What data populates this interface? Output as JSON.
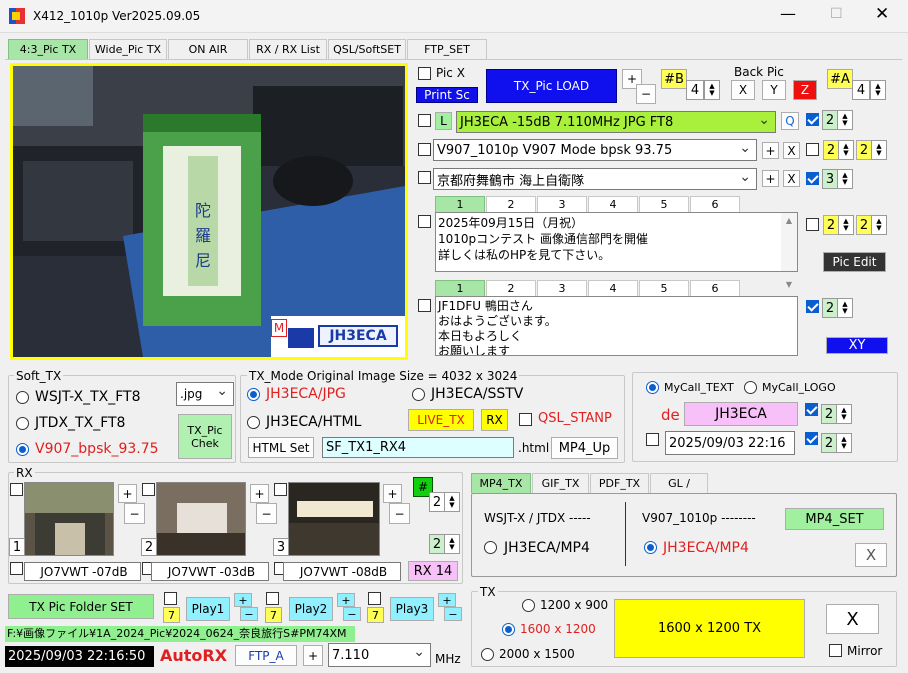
{
  "window": {
    "title": "X412_1010p",
    "version": "Ver2025.09.05"
  },
  "tabs": [
    "4:3_Pic TX",
    "Wide_Pic TX",
    "ON AIR",
    "RX / RX List",
    "QSL/SoftSET",
    "FTP_SET"
  ],
  "image": {
    "badge": "M",
    "logo": "JH3ECA"
  },
  "pic": {
    "picx": "Pic X",
    "print": "Print Sc",
    "load": "TX_Pic  LOAD",
    "plus": "+",
    "minus": "−",
    "b": "#B",
    "bval": "4",
    "backpic": "Back Pic",
    "x": "X",
    "y": "Y",
    "z": "Z",
    "a": "#A",
    "aval": "4"
  },
  "line1": {
    "l": "L",
    "text": "JH3ECA  -15dB  7.110MHz  JPG  FT8",
    "q": "Q",
    "n": "2"
  },
  "line2": {
    "text": "V907_1010p  V907  Mode   bpsk  93.75",
    "plus": "+",
    "x": "X",
    "n1": "2",
    "n2": "2"
  },
  "line3": {
    "text": "京都府舞鶴市  海上自衛隊",
    "plus": "+",
    "x": "X",
    "n": "3"
  },
  "memoTabs": [
    "1",
    "2",
    "3",
    "4",
    "5",
    "6"
  ],
  "memo1": {
    "l1": "2025年09月15日（月祝）",
    "l2": "1010pコンテスト 画像通信部門を開催",
    "l3": "詳しくは私のHPを見て下さい。",
    "n1": "2",
    "n2": "2",
    "edit": "Pic  Edit"
  },
  "memo2": {
    "l1": "JF1DFU 鴨田さん",
    "l2": "おはようございます。",
    "l3": "本日もよろしく",
    "l4": "お願いします",
    "n": "2",
    "xy": "XY"
  },
  "softtx": {
    "title": "Soft_TX",
    "o1": "WSJT-X_TX_FT8",
    "o2": "JTDX_TX_FT8",
    "o3": "V907_bpsk_93.75",
    "fmt": ".jpg",
    "check": "TX_Pic Chek"
  },
  "txmode": {
    "title": "TX_Mode  Original  Image  Size = 4032 x 3024",
    "o1": "JH3ECA/JPG",
    "o2": "JH3ECA/SSTV",
    "o3": "JH3ECA/HTML",
    "live": "LIVE_TX",
    "rx": "RX",
    "qsl": "QSL_STANP",
    "html": "HTML Set",
    "file": "SF_TX1_RX4",
    "ext": ".html",
    "mp4": "MP4_Up"
  },
  "mycall": {
    "text": "MyCall_TEXT",
    "logo": "MyCall_LOGO",
    "de": "de",
    "call": "JH3ECA",
    "n1": "2",
    "date": "2025/09/03  22:16",
    "n2": "2"
  },
  "rx": {
    "title": "RX",
    "num1": "1",
    "num2": "2",
    "num3": "3",
    "c1": "JO7VWT  -07dB",
    "c2": "JO7VWT  -03dB",
    "c3": "JO7VWT  -08dB",
    "hash": "#",
    "n1": "2",
    "n2": "2",
    "rx14": "RX 14",
    "plus": "+",
    "minus": "−"
  },
  "mp4": {
    "tabs": [
      "MP4_TX",
      "GIF_TX",
      "PDF_TX",
      "GL /"
    ],
    "wsjt": "WSJT-X / JTDX -----",
    "v907": "V907_1010p --------",
    "set": "MP4_SET",
    "o1": "JH3ECA/MP4",
    "o2": "JH3ECA/MP4",
    "x": "X"
  },
  "folder": {
    "set": "TX Pic  Folder SET",
    "p1": "Play1",
    "p2": "Play2",
    "p3": "Play3",
    "seven": "7",
    "path": "F:¥画像ファイル¥1A_2024_Pic¥2024_0624_奈良旅行S#PM74XM"
  },
  "status": {
    "clock": "2025/09/03   22:16:50",
    "auto": "AutoRX",
    "ftp": "FTP_A",
    "plus": "+",
    "freq": "7.110",
    "mhz": "MHz"
  },
  "tx": {
    "title": "TX",
    "r1": "1200 x 900",
    "r2": "1600 x 1200",
    "r3": "2000 x 1500",
    "button": "1600 x 1200   TX",
    "x": "X",
    "mirror": "Mirror"
  }
}
